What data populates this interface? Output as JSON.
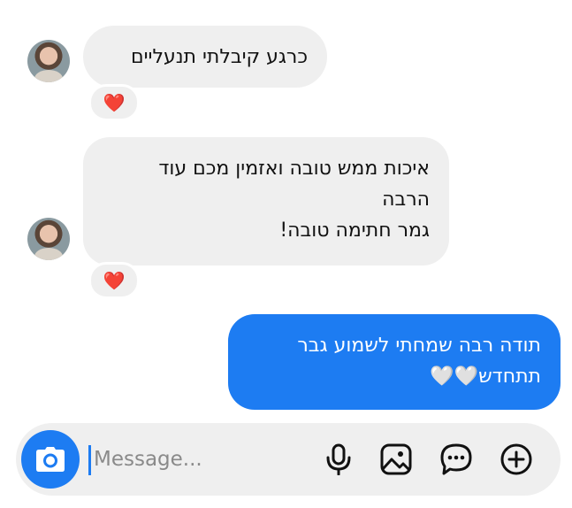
{
  "messages": [
    {
      "direction": "incoming",
      "lines": [
        "כרגע קיבלתי תנעליים"
      ],
      "reaction": "❤️"
    },
    {
      "direction": "incoming",
      "lines": [
        "איכות ממש טובה ואזמין מכם עוד",
        "הרבה",
        "גמר חתימה טובה!"
      ],
      "reaction": "❤️"
    },
    {
      "direction": "outgoing",
      "lines": [
        "תודה רבה שמחתי לשמוע גבר",
        "תתחדש🤍🤍"
      ]
    }
  ],
  "composer": {
    "placeholder": "Message..."
  },
  "colors": {
    "accent": "#1d7cf2",
    "incoming_bubble": "#efefef",
    "reaction_heart": "#e8122a"
  },
  "icons": [
    "camera-icon",
    "microphone-icon",
    "gallery-icon",
    "sticker-icon",
    "add-icon"
  ]
}
